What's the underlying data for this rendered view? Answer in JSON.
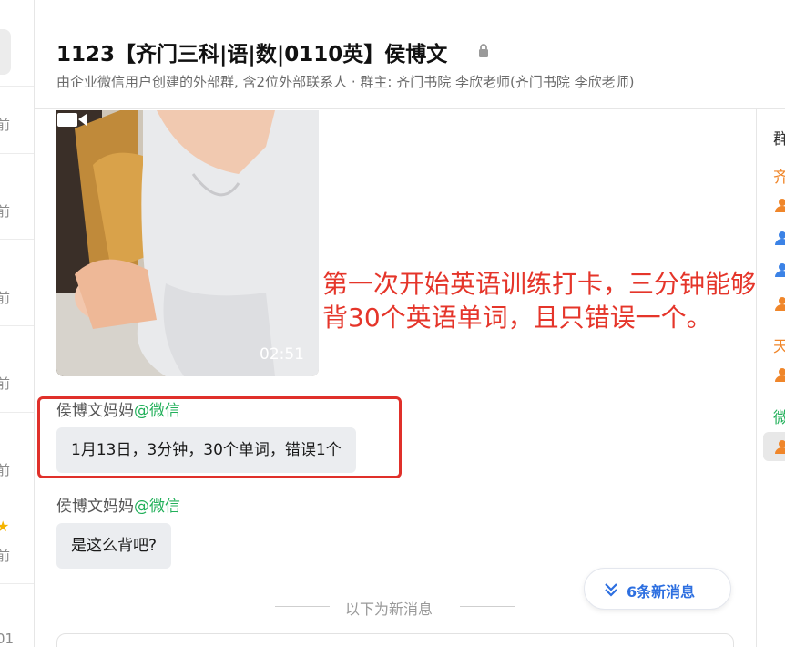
{
  "left_list": {
    "times": [
      "前",
      "前",
      "前",
      "前",
      "前",
      "前"
    ],
    "bottom_text": "01"
  },
  "header": {
    "title": "1123【齐门三科|语|数|0110英】侯博文",
    "subtitle": "由企业微信用户创建的外部群, 含2位外部联系人 · 群主: 齐门书院 李欣老师(齐门书院 李欣老师)"
  },
  "right_panel": {
    "heading": "群",
    "group1": "齐",
    "group2": "天",
    "group3": "微",
    "colors": {
      "orange": "#f0862a",
      "blue": "#3b82e6",
      "green": "#22b05a"
    }
  },
  "video": {
    "duration": "02:51"
  },
  "annotation": {
    "text": "第一次开始英语训练打卡，三分钟能够背30个英语单词，且只错误一个。",
    "color": "#e5352a"
  },
  "messages": [
    {
      "sender": "侯博文妈妈",
      "tag": "@微信",
      "text": "1月13日，3分钟，30个单词，错误1个"
    },
    {
      "sender": "侯博文妈妈",
      "tag": "@微信",
      "text": "是这么背吧?"
    }
  ],
  "new_messages_button": {
    "label": "6条新消息",
    "icon": "double-chevron-down-icon"
  },
  "divider": {
    "label": "以下为新消息"
  }
}
